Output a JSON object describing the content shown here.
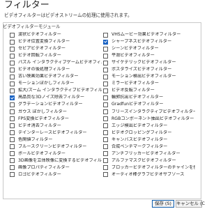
{
  "dialog": {
    "title": "フィルター",
    "description": "ビデオフィルターはビデオストリームの処理に使用されます。",
    "group_label": "ビデオフィルターモジュール"
  },
  "filters_left": [
    {
      "label": "波状ビデオフィルター",
      "checked": false
    },
    {
      "label": "ビデオ位置変換フィルター",
      "checked": false
    },
    {
      "label": "セピアビデオフィルター",
      "checked": false
    },
    {
      "label": "ビデオ回転フィルター",
      "checked": false
    },
    {
      "label": "パズル インタラクティブゲームビデオフィルター",
      "checked": false
    },
    {
      "label": "ビデオの後処理フィルター",
      "checked": false
    },
    {
      "label": "古い映画効果ビデオフィルター",
      "checked": false
    },
    {
      "label": "モーションぼかしフィルター",
      "checked": false
    },
    {
      "label": "拡大/ズーム インタラクティブビデオフィルター",
      "checked": false
    },
    {
      "label": "高品質な3Dノイズ除去フィルター",
      "checked": true
    },
    {
      "label": "グラデーションビデオフィルター",
      "checked": false
    },
    {
      "label": "ガウス ぼかしフィルター",
      "checked": false
    },
    {
      "label": "FPS変換ビデオフィルター",
      "checked": false
    },
    {
      "label": "ビデオ消去フィルター",
      "checked": false
    },
    {
      "label": "デインターレースビデオフィルター",
      "checked": false
    },
    {
      "label": "色関値フィルター",
      "checked": false
    },
    {
      "label": "ブルースクリーンビデオフィルター",
      "checked": false
    },
    {
      "label": "ボールビデオフィルター",
      "checked": false
    },
    {
      "label": "3D画像を立体映像に変換するビデオフィルター",
      "checked": false
    },
    {
      "label": "画像プロパティフィルター",
      "checked": false
    },
    {
      "label": "ロゴビデオフィルター",
      "checked": false
    }
  ],
  "filters_right": [
    {
      "label": "VHSムービー効果ビデオフィルター",
      "checked": false
    },
    {
      "label": "シャープネスビデオフィルター",
      "checked": true
    },
    {
      "label": "シーンビデオフィルター",
      "checked": false
    },
    {
      "label": "平滑ビデオフィルター",
      "checked": false
    },
    {
      "label": "サイケデリックビデオフィルター",
      "checked": false
    },
    {
      "label": "ポスタライズビデオフィルター",
      "checked": false
    },
    {
      "label": "モーション検出ビデオフィルター",
      "checked": false
    },
    {
      "label": "ミラービデオフィルター",
      "checked": false
    },
    {
      "label": "ビデオ反転フィルター",
      "checked": false
    },
    {
      "label": "輪郭抗出ビデオフィルター",
      "checked": false
    },
    {
      "label": "Gradfunビデオフィルター",
      "checked": false
    },
    {
      "label": "フリーズインタラクティブビデオフィルター",
      "checked": false
    },
    {
      "label": "RGBコンポーネント抽出ビデオフィルター",
      "checked": false
    },
    {
      "label": "エッジ検出ビデオフィルター",
      "checked": false
    },
    {
      "label": "ビデオクロッピングフィルター",
      "checked": false
    },
    {
      "label": "キャンバスビデオフィルター",
      "checked": false
    },
    {
      "label": "合成ベンチマークフィルター",
      "checked": false
    },
    {
      "label": "アンチフリッカービデオフィルター",
      "checked": false
    },
    {
      "label": "アルファマスクビデオフィルター",
      "checked": false
    },
    {
      "label": "ブロッカービデオフィルターのチャインを使用",
      "checked": false
    },
    {
      "label": "オーディオ棒グラフビデオサブソース",
      "checked": false
    }
  ],
  "buttons": {
    "save": "保存 (S)",
    "cancel": "キャンセル (C)"
  },
  "colors": {
    "checked_accent": "#1c64c4",
    "default_button_border": "#0b5cad"
  }
}
